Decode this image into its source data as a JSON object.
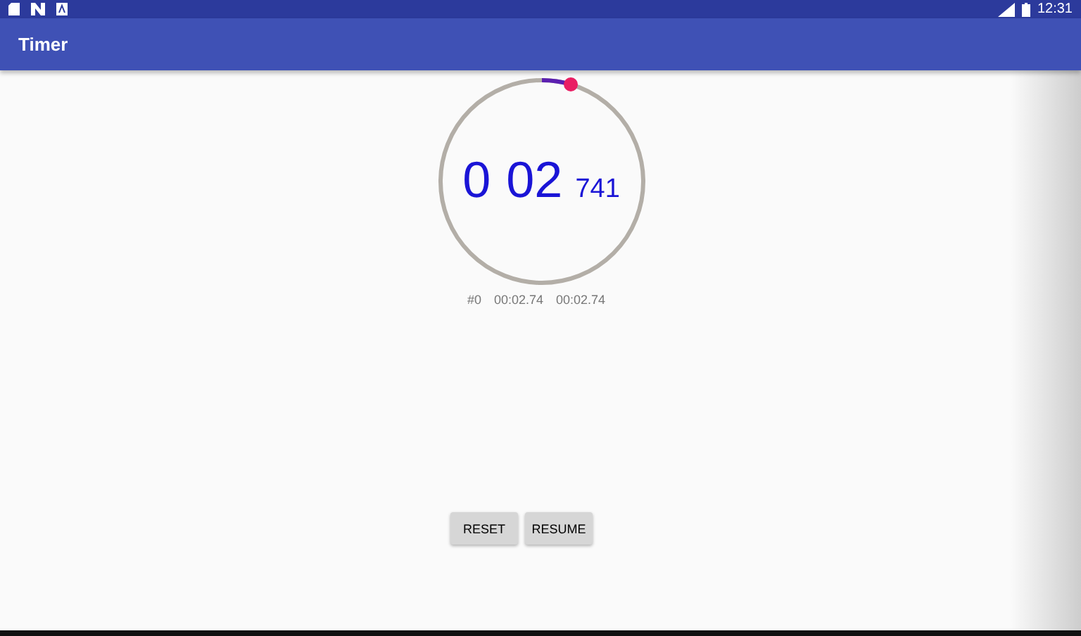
{
  "status_bar": {
    "time": "12:31"
  },
  "app_bar": {
    "title": "Timer"
  },
  "timer": {
    "minutes": "0",
    "seconds": "02",
    "millis": "741"
  },
  "laps": [
    {
      "number": "#0",
      "lap_time": "00:02.74",
      "total_time": "00:02.74"
    }
  ],
  "buttons": [
    {
      "label": "RESET"
    },
    {
      "label": "RESUME"
    }
  ]
}
